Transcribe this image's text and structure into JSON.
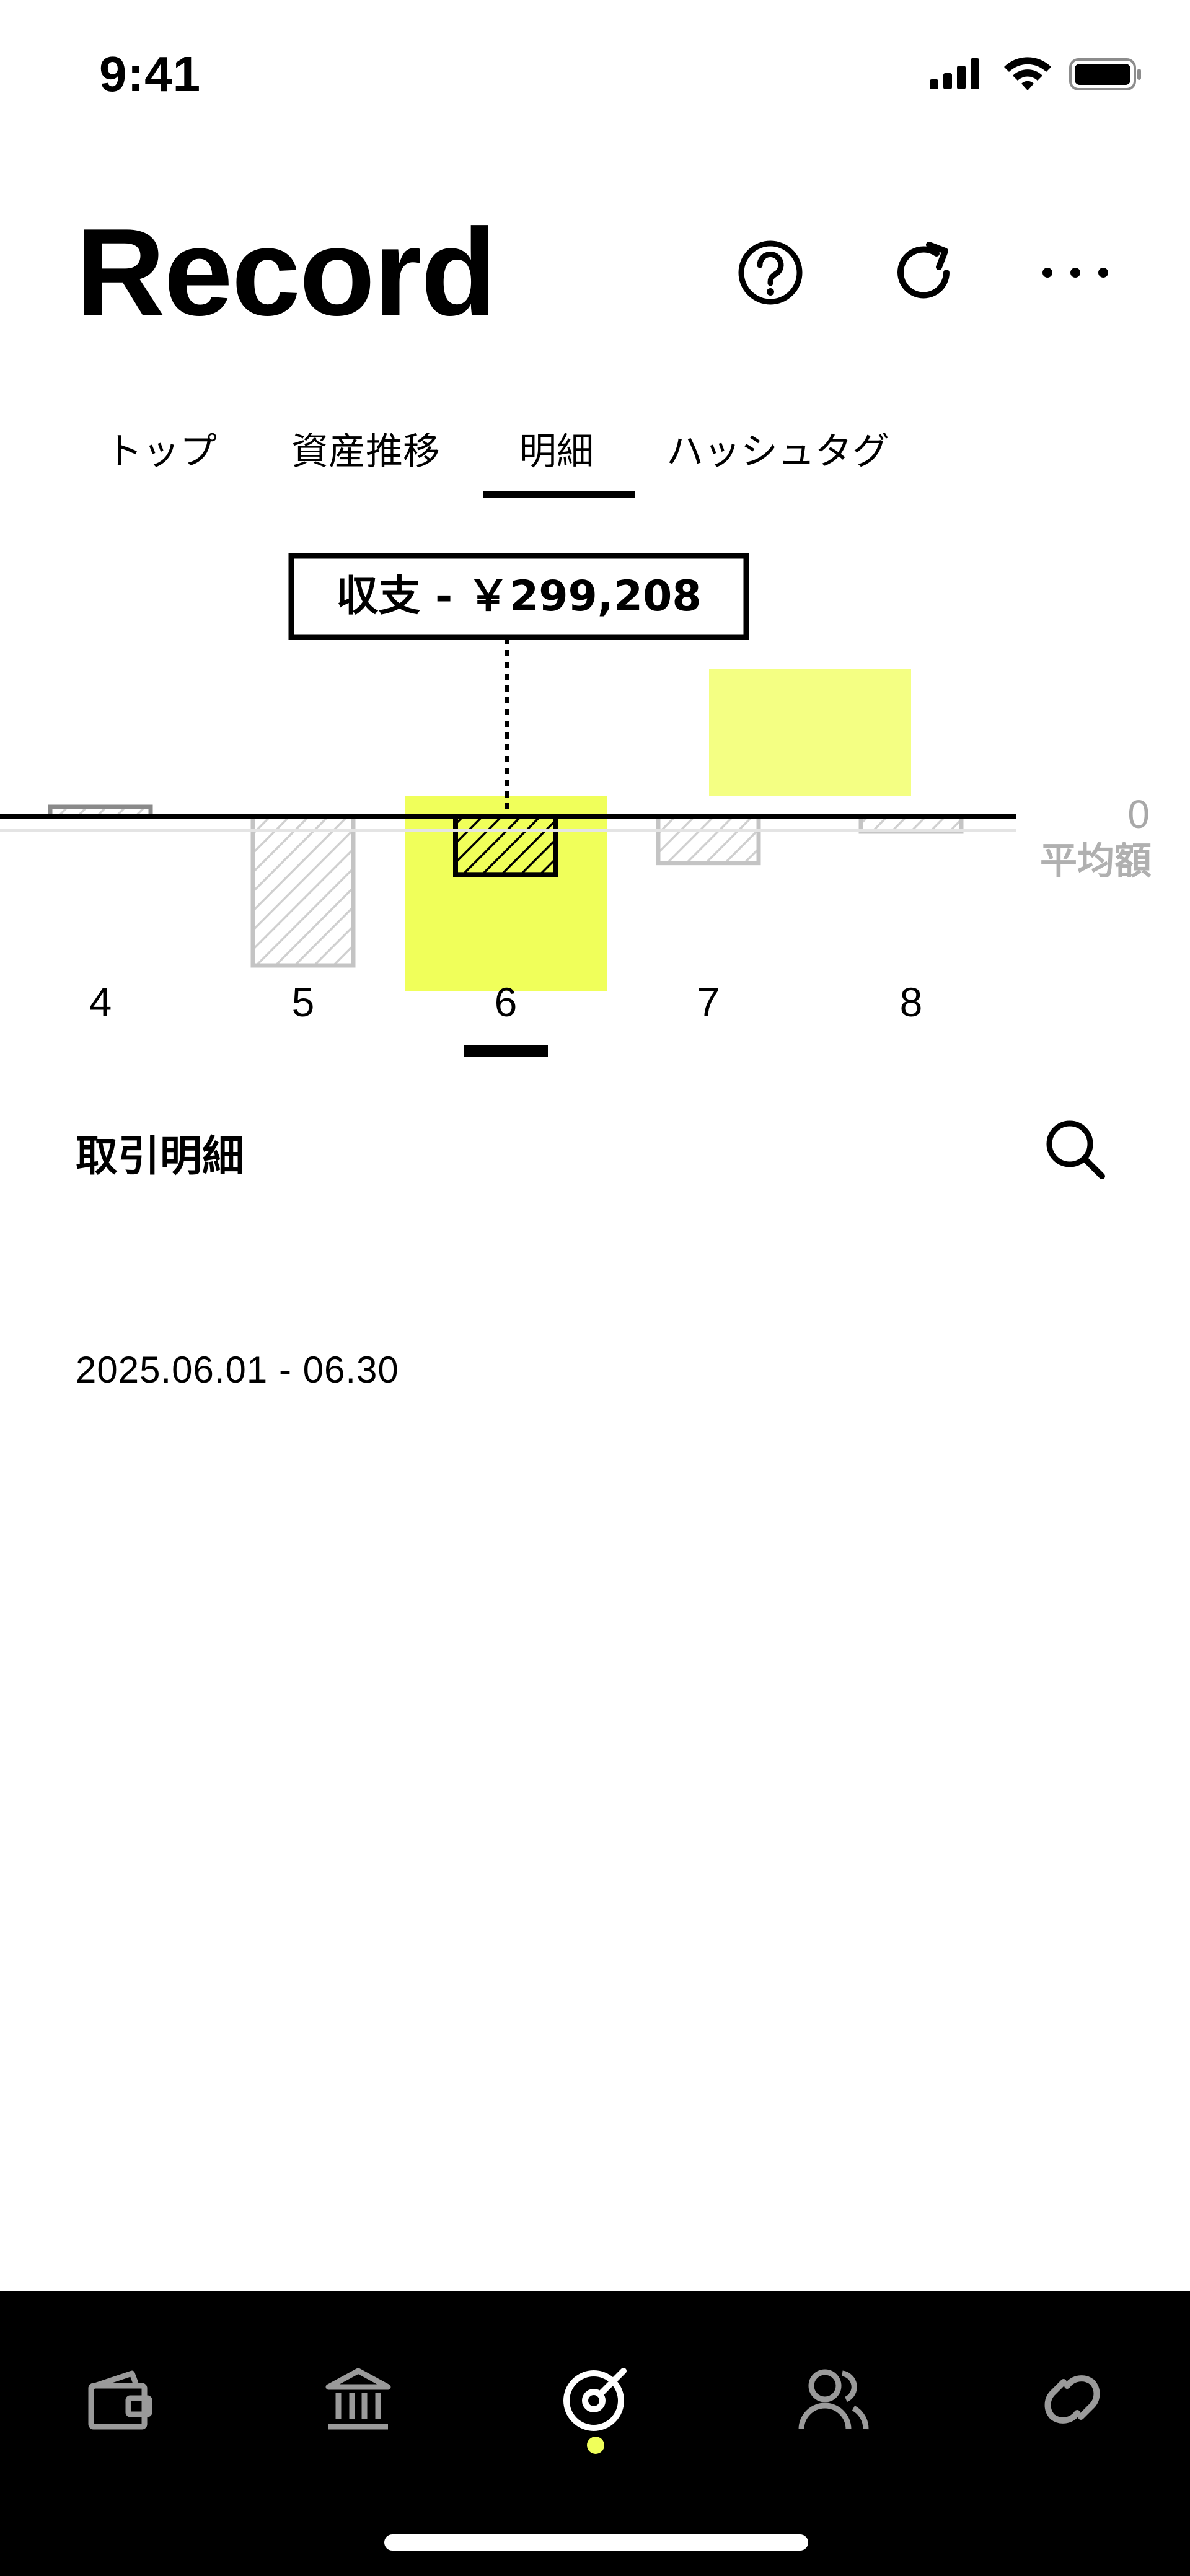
{
  "status_bar": {
    "time": "9:41"
  },
  "header": {
    "title": "Record",
    "help_icon": "question-circle-icon",
    "refresh_icon": "refresh-icon",
    "more_icon": "ellipsis-icon"
  },
  "tabs": [
    {
      "label": "トップ",
      "active": false
    },
    {
      "label": "資産推移",
      "active": false
    },
    {
      "label": "明細",
      "active": true
    },
    {
      "label": "ハッシュタグ",
      "active": false
    }
  ],
  "chart_data": {
    "type": "bar",
    "categories": [
      "4",
      "5",
      "6",
      "7",
      "8"
    ],
    "values": [
      6000,
      -90000,
      -35000,
      -28000,
      -9000
    ],
    "selected_index": 2,
    "tooltip": "収支 - ￥299,208",
    "baseline_label": "0",
    "average_label": "平均額",
    "highlight_color": "#f0ff5a"
  },
  "section": {
    "title": "取引明細",
    "search_icon": "search-icon"
  },
  "date_range": "2025.06.01 - 06.30",
  "bottom_nav": [
    {
      "icon": "wallet-icon",
      "active": false
    },
    {
      "icon": "bank-icon",
      "active": false
    },
    {
      "icon": "record-icon",
      "active": true
    },
    {
      "icon": "people-icon",
      "active": false
    },
    {
      "icon": "link-icon",
      "active": false
    }
  ],
  "colors": {
    "accent": "#f0ff5a",
    "text": "#000000",
    "muted": "#a8a8a8"
  }
}
